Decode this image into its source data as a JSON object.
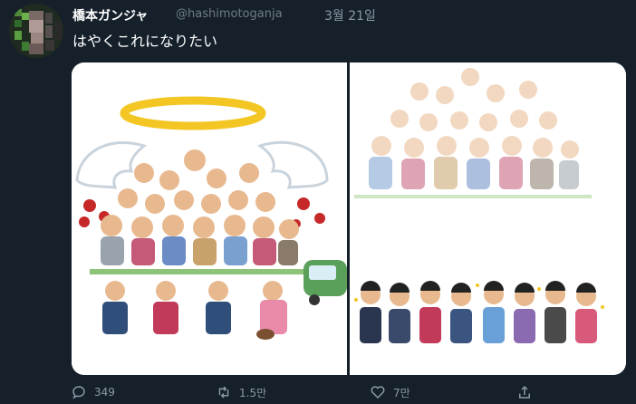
{
  "tweet": {
    "author_name": "橋本ガンジャ",
    "handle": "@hashimotoganja",
    "date": "3월 21일",
    "text": "はやくこれになりたい"
  },
  "actions": {
    "reply_count": "349",
    "retweet_count": "1.5만",
    "like_count": "7만"
  }
}
